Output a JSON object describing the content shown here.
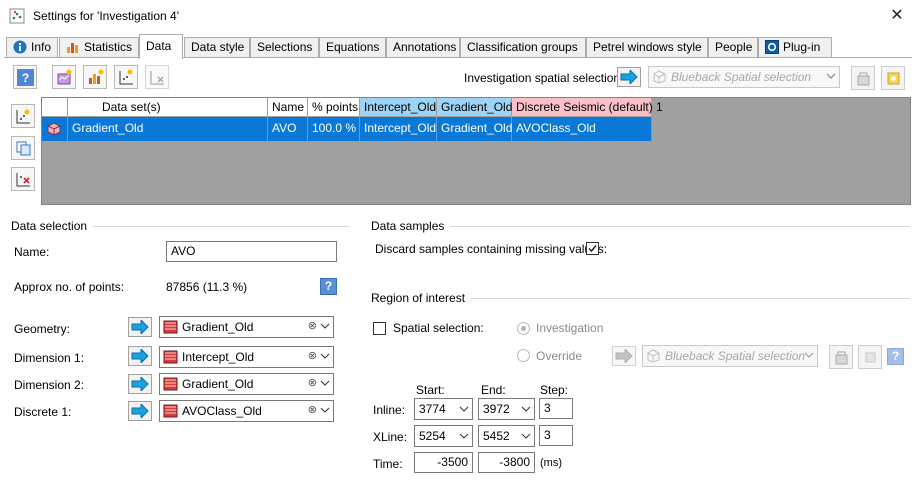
{
  "window": {
    "title": "Settings for 'Investigation 4'",
    "close_glyph": "✕"
  },
  "tabs": [
    {
      "label": "Info",
      "icon": "info-icon"
    },
    {
      "label": "Statistics",
      "icon": "bar-chart-icon"
    },
    {
      "label": "Data",
      "active": true
    },
    {
      "label": "Data style"
    },
    {
      "label": "Selections"
    },
    {
      "label": "Equations"
    },
    {
      "label": "Annotations"
    },
    {
      "label": "Classification groups"
    },
    {
      "label": "Petrel windows style"
    },
    {
      "label": "People"
    },
    {
      "label": "Plug-in",
      "icon": "plugin-icon"
    }
  ],
  "toolbar": {
    "spatial_label": "Investigation spatial selection:",
    "spatial_placeholder": "Blueback Spatial selection"
  },
  "grid": {
    "headers": [
      "Data set(s)",
      "Name",
      "% points",
      "Intercept_Old",
      "Gradient_Old",
      "Discrete Seismic (default) 1"
    ],
    "rows": [
      {
        "dataset": "Gradient_Old",
        "name": "AVO",
        "points": "100.0 %",
        "intercept": "Intercept_Old",
        "gradient": "Gradient_Old",
        "discrete": "AVOClass_Old"
      }
    ]
  },
  "data_selection": {
    "section_title": "Data selection",
    "name_label": "Name:",
    "name_value": "AVO",
    "points_label": "Approx no. of points:",
    "points_value": "87856 (11.3 %)",
    "geometry_label": "Geometry:",
    "geometry_value": "Gradient_Old",
    "dim1_label": "Dimension 1:",
    "dim1_value": "Intercept_Old",
    "dim2_label": "Dimension 2:",
    "dim2_value": "Gradient_Old",
    "discrete_label": "Discrete 1:",
    "discrete_value": "AVOClass_Old"
  },
  "data_samples": {
    "section_title": "Data samples",
    "discard_label": "Discard samples containing missing values:",
    "discard_checked": true
  },
  "region": {
    "section_title": "Region of interest",
    "spatial_label": "Spatial selection:",
    "spatial_checked": false,
    "investigation_label": "Investigation",
    "override_label": "Override",
    "override_placeholder": "Blueback Spatial selection",
    "start_label": "Start:",
    "end_label": "End:",
    "step_label": "Step:",
    "inline_label": "Inline:",
    "inline_start": "3774",
    "inline_end": "3972",
    "inline_step": "3",
    "xline_label": "XLine:",
    "xline_start": "5254",
    "xline_end": "5452",
    "xline_step": "3",
    "time_label": "Time:",
    "time_start": "-3500",
    "time_end": "-3800",
    "time_unit": "(ms)"
  },
  "help_glyph": "?"
}
